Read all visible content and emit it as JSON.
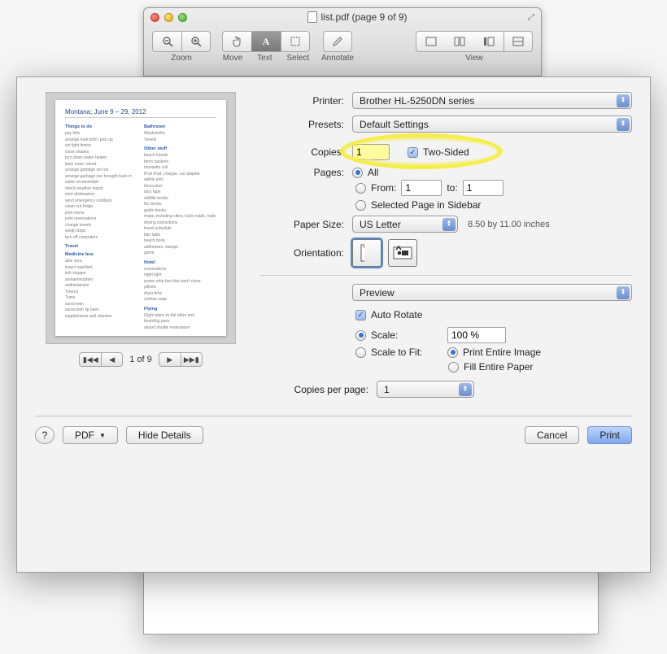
{
  "window": {
    "title": "list.pdf (page 9 of 9)"
  },
  "toolbar": {
    "zoom_label": "Zoom",
    "move_label": "Move",
    "text_label": "Text",
    "select_label": "Select",
    "annotate_label": "Annotate",
    "view_label": "View"
  },
  "preview_doc": {
    "title": "Montana; June 9 – 29, 2012",
    "sections": {
      "things_to_do": {
        "h": "Things to do",
        "body": "pay bills\narrange mail hold / pick up\nset light timers\nclose shades\nturn down water heater\nlawn mow / weed\narrange garbage set out\narrange garbage can brought back in\nwater ornamentals\ncheck weather report\nstart dishwasher\nsend emergency numbers\nclean out fridge\nprint menu\nprint reservations\nchange towels\nweigh bags\nturn off computers"
      },
      "bathroom": {
        "h": "Bathroom",
        "body": "Washcloths\nTowels"
      },
      "other": {
        "h": "Other stuff",
        "body": "beach towels\nberry baskets\nmosquito coil\niPod iPad, charger, car adapter\nsafety pins\nbinoculars\nduct tape\nwildlife books\nfun books\nguide books\nmaps, including cities, back roads, trails\ndriving instructions\ntravel schedule\ntide table\nbeach book\naddresses, stamps\ngame"
      },
      "travel": {
        "h": "Travel",
        "body": ""
      },
      "medicine": {
        "h": "Medicine box",
        "body": "aloe vera\ninsect repellant\nitch stopper\nacetaminophen\nantihistamine\nTylenol\nTums\nsunscreen\nsunscreen lip balm\nsupplements and vitamins"
      },
      "hotel": {
        "h": "Hotel",
        "body": "reservations\nnight light\npower strip box that won't close\npillows\ndryer time\nclothes soap"
      },
      "flying": {
        "h": "Flying",
        "body": "Flight plans to the other end\nboarding pass\nairport shuttle reservation"
      }
    }
  },
  "page_nav": {
    "label": "1 of 9"
  },
  "print": {
    "labels": {
      "printer": "Printer:",
      "presets": "Presets:",
      "copies": "Copies:",
      "two_sided": "Two-Sided",
      "pages": "Pages:",
      "all": "All",
      "from": "From:",
      "to": "to:",
      "selected_page": "Selected Page in Sidebar",
      "paper_size": "Paper Size:",
      "paper_dim": "8.50 by 11.00 inches",
      "orientation": "Orientation:",
      "app_menu": "Preview",
      "auto_rotate": "Auto Rotate",
      "scale": "Scale:",
      "scale_to_fit": "Scale to Fit:",
      "print_entire_image": "Print Entire Image",
      "fill_entire_paper": "Fill Entire Paper",
      "copies_per_page": "Copies per page:"
    },
    "values": {
      "printer": "Brother HL-5250DN series",
      "presets": "Default Settings",
      "copies": "1",
      "two_sided": true,
      "pages_mode": "all",
      "from": "1",
      "to": "1",
      "paper_size": "US Letter",
      "auto_rotate": true,
      "scale_mode": "scale",
      "scale_pct": "100 %",
      "fit_mode": "print_entire",
      "copies_per_page": "1"
    }
  },
  "footer": {
    "pdf_menu": "PDF",
    "hide_details": "Hide Details",
    "cancel": "Cancel",
    "print": "Print"
  }
}
